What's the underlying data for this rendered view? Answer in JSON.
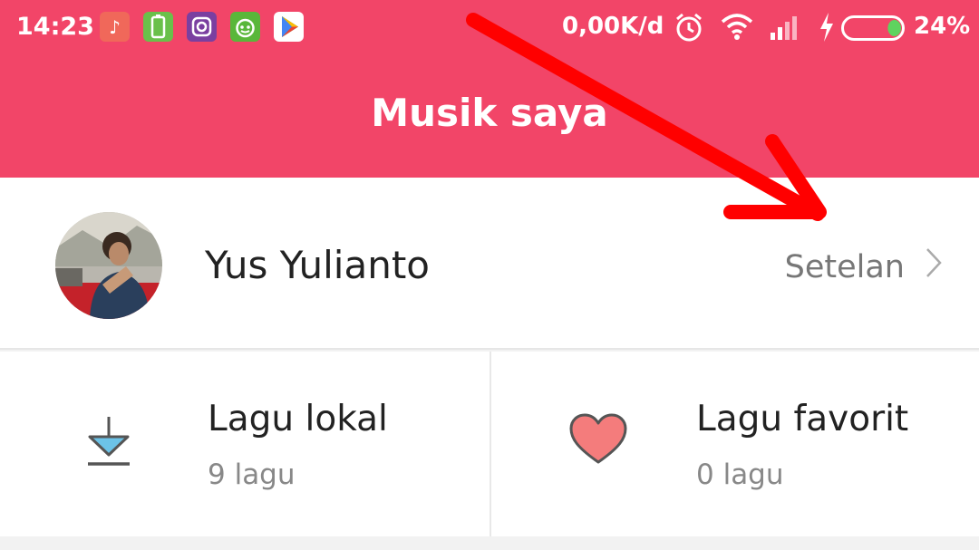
{
  "status_bar": {
    "time": "14:23",
    "net_speed": "0,00K/d",
    "battery_percent": "24%",
    "battery_level": 0.24,
    "app_icons": [
      "tiktok-icon",
      "battery-app-icon",
      "instagram-icon",
      "android-bot-icon",
      "play-store-icon"
    ]
  },
  "header": {
    "title": "Musik saya"
  },
  "profile": {
    "name": "Yus Yulianto",
    "settings_label": "Setelan"
  },
  "library": {
    "local": {
      "title": "Lagu lokal",
      "count": "9 lagu"
    },
    "favorite": {
      "title": "Lagu favorit",
      "count": "0 lagu"
    }
  },
  "colors": {
    "accent": "#f24568",
    "arrow": "#ff0000",
    "heart": "#f47c7c",
    "download_fill": "#6cc3e8"
  }
}
